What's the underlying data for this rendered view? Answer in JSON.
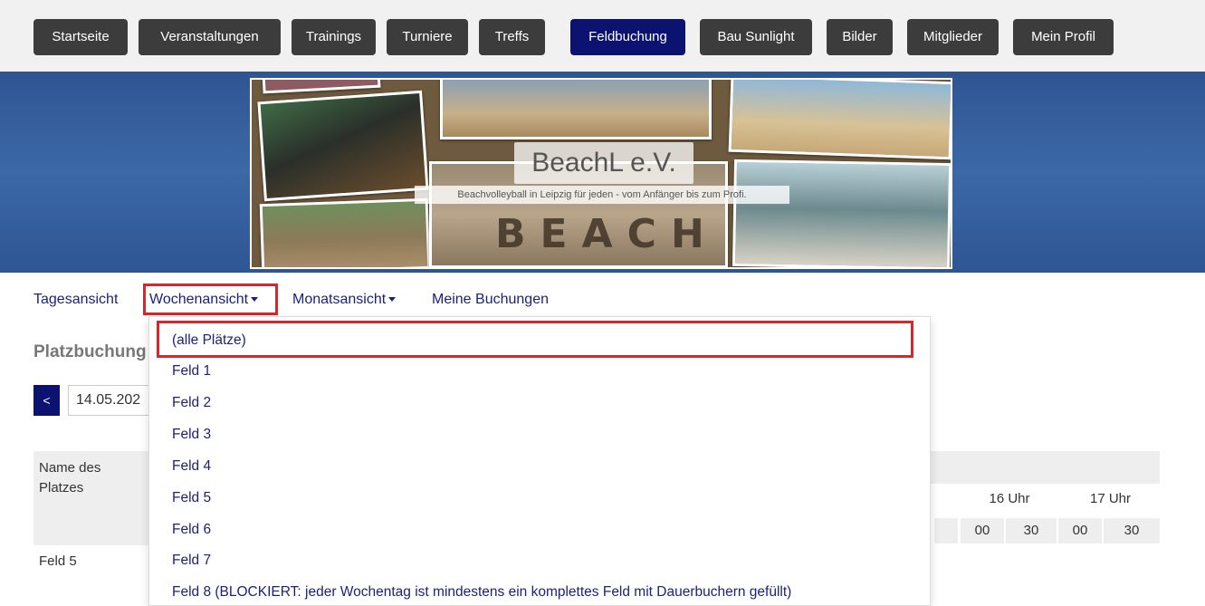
{
  "nav": {
    "items": [
      {
        "label": "Startseite"
      },
      {
        "label": "Veranstaltungen"
      },
      {
        "label": "Trainings"
      },
      {
        "label": "Turniere"
      },
      {
        "label": "Treffs"
      },
      {
        "label": "Feldbuchung"
      },
      {
        "label": "Bau Sunlight"
      },
      {
        "label": "Bilder"
      },
      {
        "label": "Mitglieder"
      },
      {
        "label": "Mein Profil"
      }
    ],
    "active": "Feldbuchung"
  },
  "banner": {
    "title": "BeachL e.V.",
    "subtitle": "Beachvolleyball in Leipzig für jeden - vom Anfänger bis zum Profi.",
    "photo_text": "BEACH"
  },
  "subnav": {
    "items": [
      {
        "label": "Tagesansicht"
      },
      {
        "label": "Wochenansicht"
      },
      {
        "label": "Monatsansicht"
      },
      {
        "label": "Meine Buchungen"
      }
    ]
  },
  "main": {
    "heading": "Platzbuchung",
    "prev_label": "<",
    "date_value": "14.05.202",
    "table": {
      "name_header": "Name des Platzes",
      "hours": [
        "16 Uhr",
        "17 Uhr"
      ],
      "minutes": [
        "00",
        "30",
        "00",
        "30"
      ],
      "first_row": "Feld 5"
    }
  },
  "dropdown": {
    "items": [
      {
        "label": "(alle Plätze)"
      },
      {
        "label": "Feld 1"
      },
      {
        "label": "Feld 2"
      },
      {
        "label": "Feld 3"
      },
      {
        "label": "Feld 4"
      },
      {
        "label": "Feld 5"
      },
      {
        "label": "Feld 6"
      },
      {
        "label": "Feld 7"
      },
      {
        "label": "Feld 8 (BLOCKIERT: jeder Wochentag ist mindestens ein komplettes Feld mit Dauerbuchern gefüllt)"
      }
    ]
  },
  "colors": {
    "nav_button": "#3c3c3c",
    "nav_active": "#0b1270",
    "link": "#1b1f7a",
    "highlight_outline": "#d9262b",
    "banner": "#3c68a8"
  }
}
